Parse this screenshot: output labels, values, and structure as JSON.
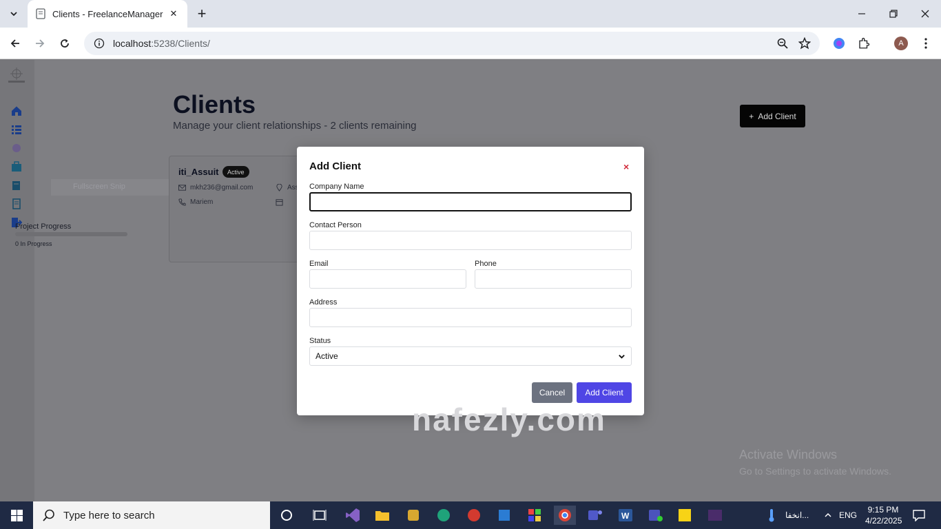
{
  "browser": {
    "tab_title": "Clients - FreelanceManager",
    "url_host": "localhost",
    "url_path": ":5238/Clients/"
  },
  "page": {
    "title": "Clients",
    "subtitle": "Manage your client relationships - 2 clients remaining",
    "add_button": "Add Client",
    "snip_text": "Fullscreen Snip"
  },
  "client_card": {
    "name": "iti_Assuit",
    "status": "Active",
    "email": "mkh236@gmail.com",
    "contact": "Mariem",
    "address_partial": "Ass",
    "progress_title": "Project Progress",
    "progress_text": "0 In Progress",
    "progress_value": 0
  },
  "modal": {
    "title": "Add Client",
    "close_glyph": "×",
    "fields": {
      "company_name": {
        "label": "Company Name",
        "value": ""
      },
      "contact_person": {
        "label": "Contact Person",
        "value": ""
      },
      "email": {
        "label": "Email",
        "value": ""
      },
      "phone": {
        "label": "Phone",
        "value": ""
      },
      "address": {
        "label": "Address",
        "value": ""
      },
      "status": {
        "label": "Status",
        "value": "Active"
      }
    },
    "cancel_label": "Cancel",
    "submit_label": "Add Client"
  },
  "windows": {
    "activate_title": "Activate Windows",
    "activate_sub": "Go to Settings to activate Windows.",
    "watermark": "nafezly.com"
  },
  "taskbar": {
    "search_placeholder": "Type here to search",
    "weather_text": "انخفا...",
    "language": "ENG",
    "time": "9:15 PM",
    "date": "4/22/2025"
  },
  "colors": {
    "primary": "#4f46e5",
    "cancel": "#6c7280",
    "close": "#d12b3b",
    "taskbar": "#1f2a44"
  }
}
